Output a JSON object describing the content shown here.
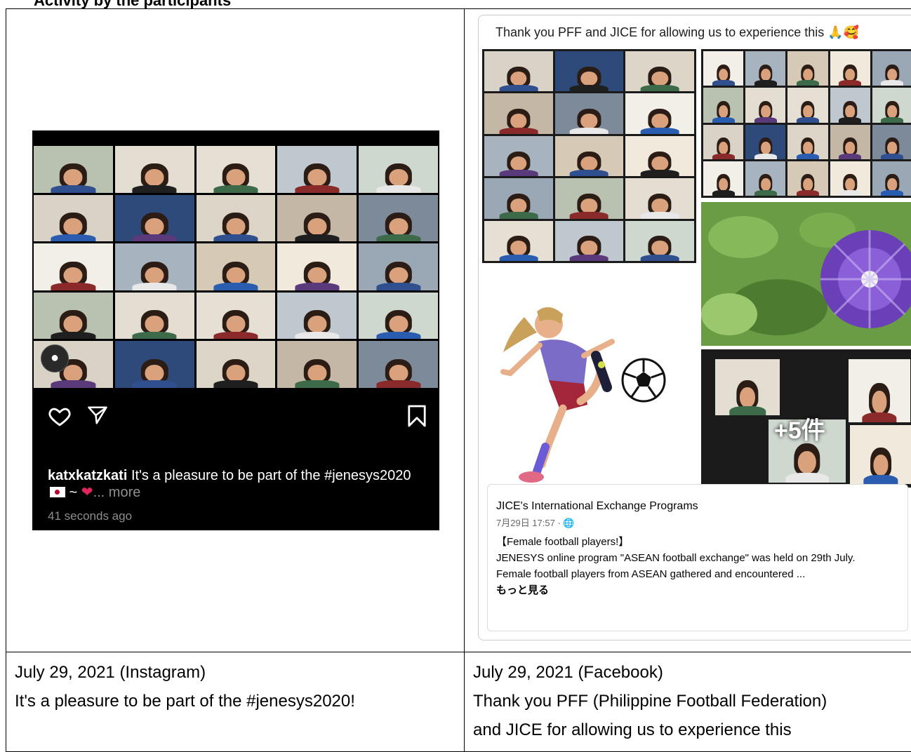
{
  "top_heading": "Activity by the participants",
  "instagram": {
    "username": "katxkatzkati",
    "caption_text": "It's a pleasure to be part of the #jenesys2020",
    "caption_suffix": " ~ ",
    "more": "... more",
    "timestamp": "41 seconds ago",
    "icons": [
      "heart-icon",
      "share-icon",
      "bookmark-icon",
      "user-avatar-icon"
    ],
    "colors": {
      "background": "#000000",
      "muted": "#8e8e8e",
      "heart": "#e0245e"
    }
  },
  "facebook": {
    "post_title": "Thank you PFF and JICE for allowing us to experience this",
    "emoji": "🙏🥰",
    "plus_count": "+5件",
    "page_name": "JICE's International Exchange Programs",
    "date_meta": "7月29日 17:57 · ",
    "headline": "【Female football players!】",
    "body_line1": "JENESYS online program \"ASEAN football exchange\" was held on 29th July.",
    "body_line2": "Female football players from ASEAN gathered and encountered ...",
    "see_more": "もっと見る",
    "icons": [
      "globe-icon",
      "soccer-ball-icon",
      "flower-photo"
    ]
  },
  "captions": {
    "left_date": "July 29, 2021 (Instagram)",
    "left_text": "It's a pleasure to be part of the #jenesys2020!",
    "right_date": "July 29, 2021 (Facebook)",
    "right_text_line1": "Thank you PFF (Philippine Football Federation)",
    "right_text_line2": "and JICE for allowing us to experience this"
  }
}
